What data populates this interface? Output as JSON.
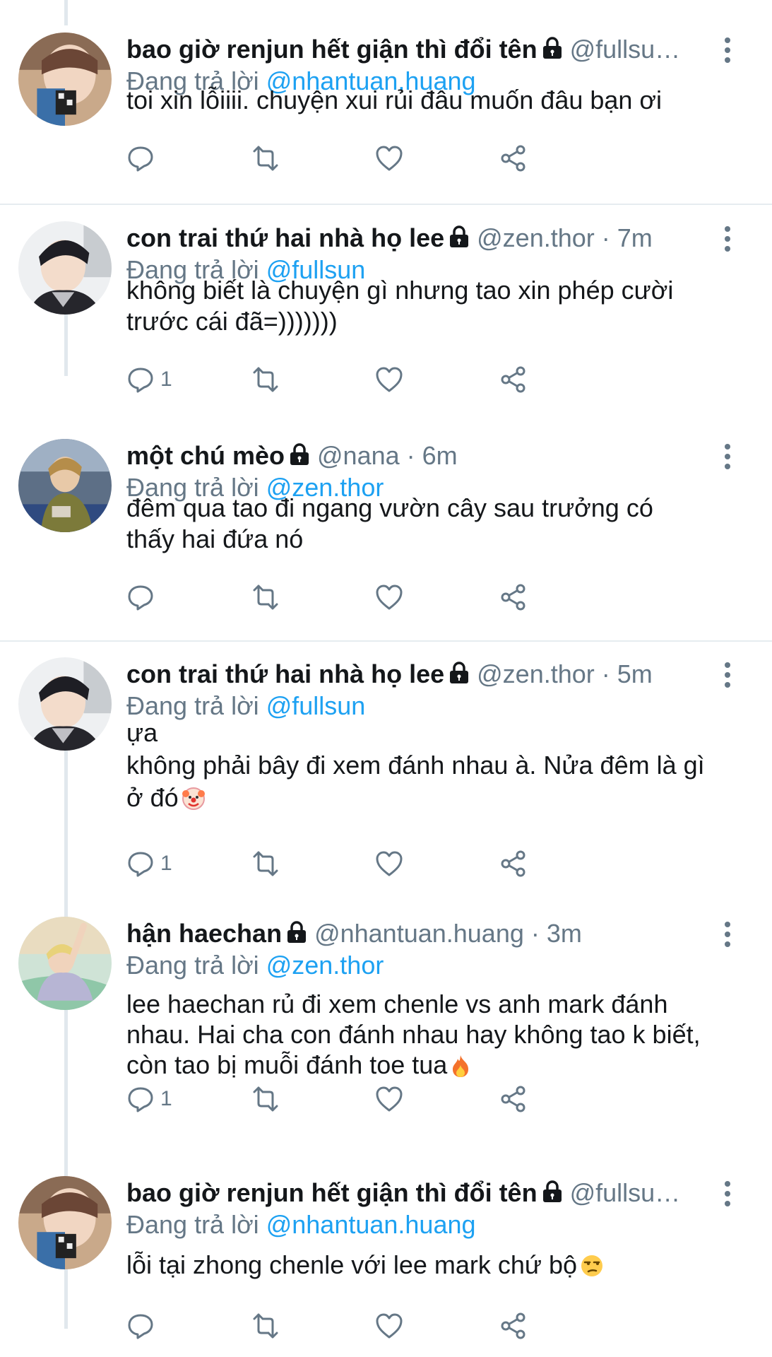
{
  "tweets": [
    {
      "display_name": "bao giờ renjun hết giận thì đổi tên",
      "handle_meta": "@fullsu…",
      "reply_prefix": "Đang trả lời",
      "reply_to": "@nhantuan.huang",
      "lines": [
        "toi xin lỗiiii. chuyện xui rủi đâu muốn đâu bạn ơi"
      ],
      "reply_count": "",
      "avatar": "avatar-renjun"
    },
    {
      "display_name": "con trai thứ hai nhà họ lee",
      "handle_meta": "@zen.thor · 7m",
      "reply_prefix": "Đang trả lời",
      "reply_to": "@fullsun",
      "lines": [
        "không biết là chuyện gì nhưng tao xin phép cười",
        "trước cái đã=)))))))"
      ],
      "reply_count": "1",
      "avatar": "avatar-jeno"
    },
    {
      "display_name": "một chú mèo",
      "handle_meta": "@nana · 6m",
      "reply_prefix": "Đang trả lời",
      "reply_to": "@zen.thor",
      "lines": [
        "đêm qua tao đi ngang vườn cây sau trưởng có",
        "thấy hai đứa nó"
      ],
      "reply_count": "",
      "avatar": "avatar-nana"
    },
    {
      "display_name": "con trai thứ hai nhà họ lee",
      "handle_meta": "@zen.thor · 5m",
      "reply_prefix": "Đang trả lời",
      "reply_to": "@fullsun",
      "lines": [
        "ựa",
        "không phải bây đi xem đánh nhau à. Nửa đêm là gì",
        "ở đó"
      ],
      "reply_count": "1",
      "avatar": "avatar-jeno"
    },
    {
      "display_name": "hận haechan",
      "handle_meta": "@nhantuan.huang · 3m",
      "reply_prefix": "Đang trả lời",
      "reply_to": "@zen.thor",
      "lines": [
        "lee haechan rủ đi xem chenle vs anh mark đánh",
        "nhau. Hai cha con đánh nhau hay không tao k biết,",
        "còn tao bị muỗi đánh toe tua"
      ],
      "reply_count": "1",
      "avatar": "avatar-guanlin"
    },
    {
      "display_name": "bao giờ renjun hết giận thì đổi tên",
      "handle_meta": "@fullsu…",
      "reply_prefix": "Đang trả lời",
      "reply_to": "@nhantuan.huang",
      "lines": [
        "lỗi tại zhong chenle với lee mark chứ bộ"
      ],
      "reply_count": "",
      "avatar": "avatar-renjun"
    }
  ],
  "colors": {
    "text": "#14171a",
    "muted": "#657786",
    "accent": "#1da1f2",
    "thread_line": "#e1e8ed",
    "divider": "#e6ecf0"
  },
  "icons": [
    "lock-icon",
    "more-icon",
    "reply-icon",
    "retweet-icon",
    "like-icon",
    "share-icon",
    "clown-emoji",
    "fire-emoji",
    "unamused-emoji"
  ]
}
